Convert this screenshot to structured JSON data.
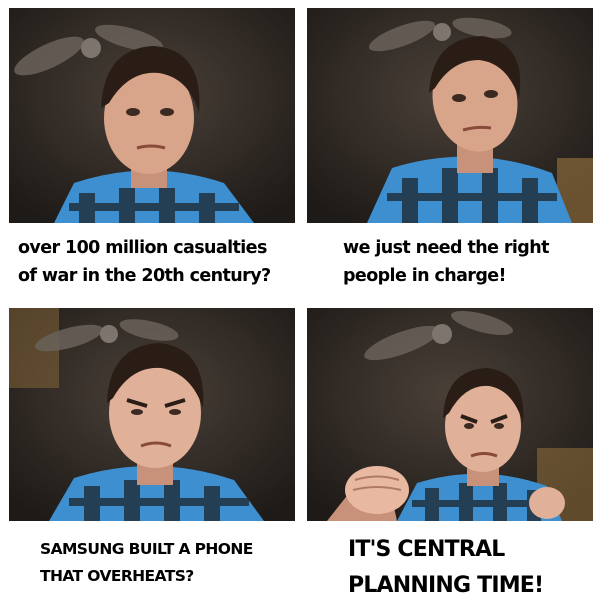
{
  "panels": [
    {
      "caption": "over 100 million casualties\nof war in the 20th century?"
    },
    {
      "caption": "we just need the right\npeople in charge!"
    },
    {
      "caption": "SAMSUNG BUILT A PHONE\nTHAT OVERHEATS?"
    },
    {
      "caption": "IT'S CENTRAL\nPLANNING TIME!"
    }
  ],
  "colors": {
    "wall": "#2b2622",
    "shirt_blue": "#3d8fd0",
    "shirt_dark": "#1f2a36",
    "skin": "#d9a58a",
    "hair": "#2a1d16",
    "background": "#ffffff",
    "text": "#000000"
  }
}
